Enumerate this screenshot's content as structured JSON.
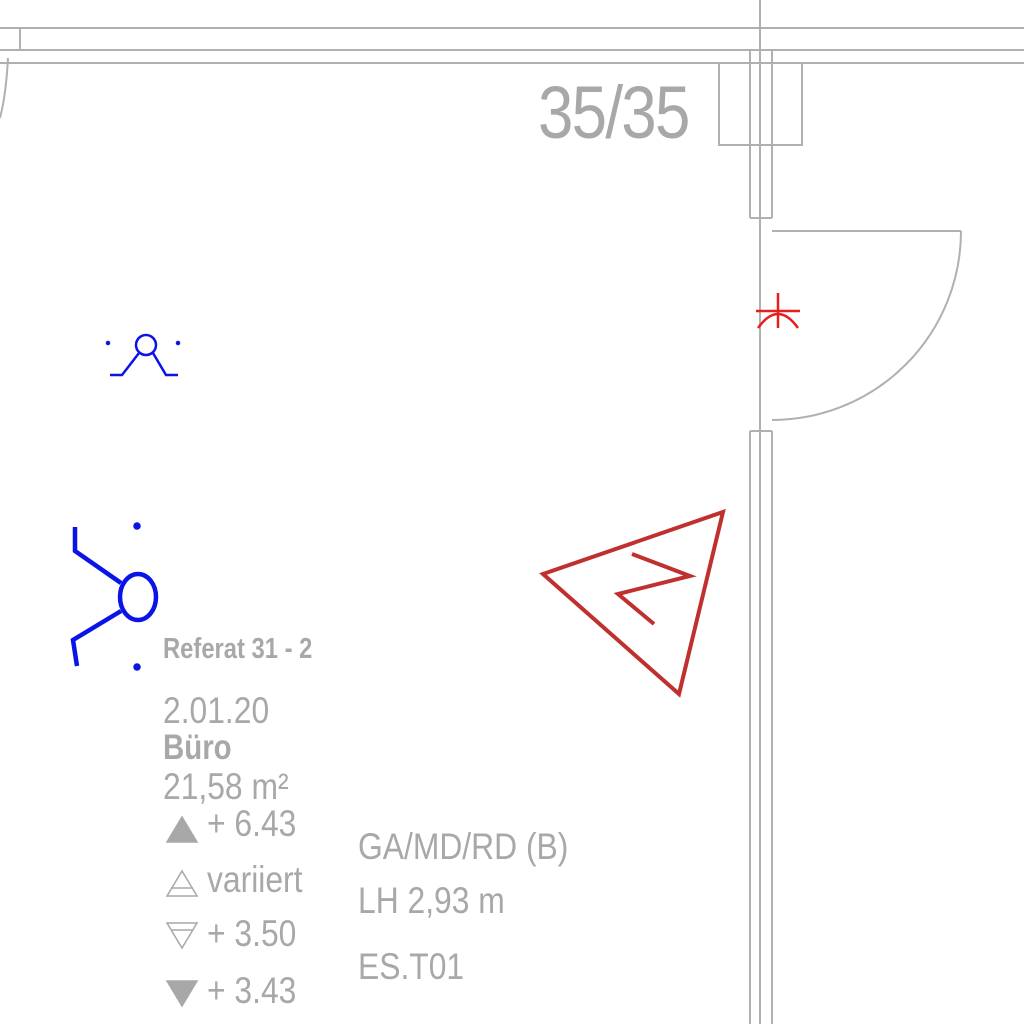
{
  "column_label": "35/35",
  "room": {
    "department": "Referat 31 -  2",
    "number": "2.01.20",
    "name": "Büro",
    "area": "21,58 m²"
  },
  "levels": [
    {
      "marker": "filled-up-triangle-icon",
      "value": "+ 6.43"
    },
    {
      "marker": "outline-up-triangle-icon",
      "value": "variiert"
    },
    {
      "marker": "outline-down-triangle-icon",
      "value": "+ 3.50"
    },
    {
      "marker": "filled-down-triangle-icon",
      "value": "+ 3.43"
    }
  ],
  "ceiling_type": "GA/MD/RD (B)",
  "clear_height": "LH 2,93 m",
  "code": "ES.T01",
  "colors": {
    "wall": "#a8a8a8",
    "electrical": "#0a14e6",
    "emergency": "#e61e1e",
    "fire_sign": "#c0302e",
    "text": "#a8a8a8"
  },
  "icons": {
    "ceiling_light": "ceiling-light-icon",
    "wall_light": "wall-light-icon",
    "door_sensor": "door-contact-icon",
    "fire_marker": "fire-extinguisher-triangle-icon"
  }
}
